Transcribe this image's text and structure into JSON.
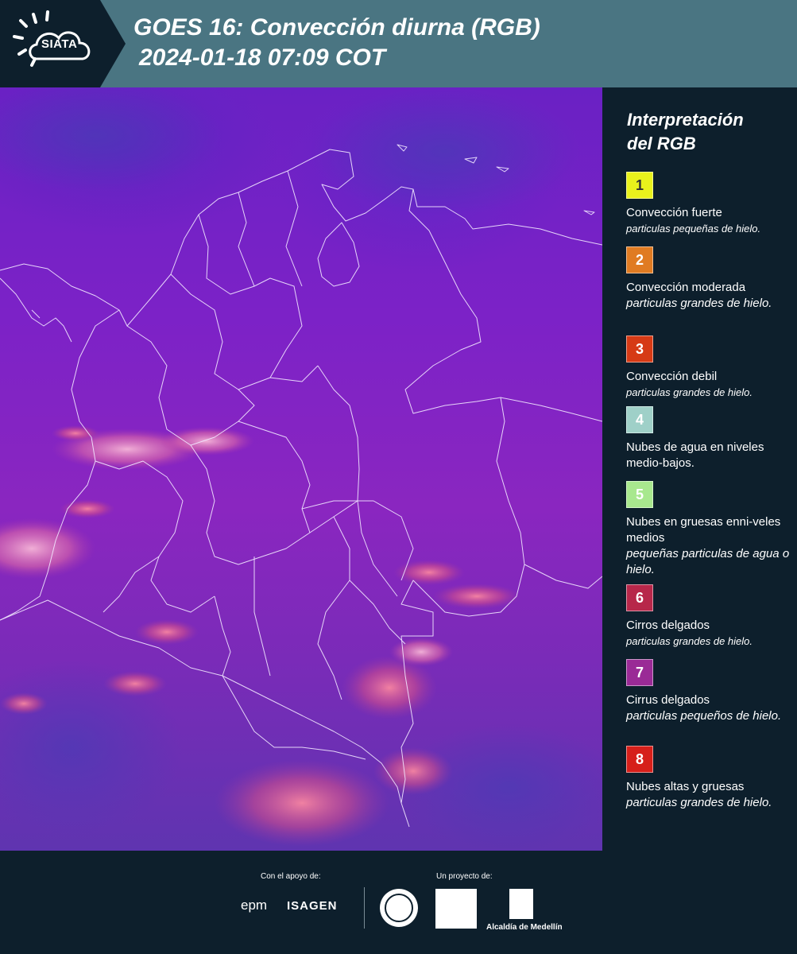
{
  "header": {
    "logo_text": "SIATA",
    "title": "GOES 16: Convección diurna (RGB)",
    "subtitle": "2024-01-18 07:09 COT"
  },
  "legend": {
    "title_line1": "Interpretación",
    "title_line2": "del RGB",
    "items": [
      {
        "number": "1",
        "color": "#e9f21c",
        "text_color": "#333333",
        "label": "Convección fuerte",
        "desc": "particulas pequeñas de hielo."
      },
      {
        "number": "2",
        "color": "#e07b22",
        "text_color": "#ffffff",
        "label": "Convección moderada",
        "desc": "particulas grandes de hielo."
      },
      {
        "number": "3",
        "color": "#d63a15",
        "text_color": "#ffffff",
        "label": "Convección debil",
        "desc": "particulas grandes de hielo."
      },
      {
        "number": "4",
        "color": "#9fd0c8",
        "text_color": "#ffffff",
        "label": "Nubes de agua en niveles medio-bajos.",
        "desc": ""
      },
      {
        "number": "5",
        "color": "#a8e88e",
        "text_color": "#ffffff",
        "label": "Nubes en gruesas enni-veles medios",
        "desc": "pequeñas particulas de agua o hielo."
      },
      {
        "number": "6",
        "color": "#b7274a",
        "text_color": "#ffffff",
        "label": "Cirros delgados",
        "desc": "particulas grandes de hielo."
      },
      {
        "number": "7",
        "color": "#9a2a96",
        "text_color": "#ffffff",
        "label": "Cirrus delgados",
        "desc": "particulas pequeños de hielo."
      },
      {
        "number": "8",
        "color": "#d61f1a",
        "text_color": "#ffffff",
        "label": "Nubes altas y gruesas",
        "desc": "particulas grandes de hielo."
      }
    ]
  },
  "footer": {
    "support_caption": "Con el apoyo de:",
    "project_caption": "Un proyecto de:",
    "sponsor_1": "epm",
    "sponsor_2": "ISAGEN",
    "partner_3": "Alcaldía de Medellín"
  }
}
